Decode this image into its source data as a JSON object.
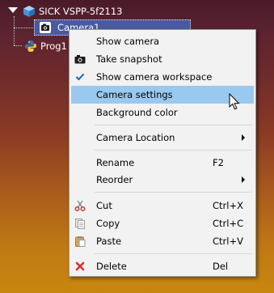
{
  "tree": {
    "root_label": "SICK VSPP-5f2113",
    "camera_label": "Camera1",
    "program_label": "Prog1"
  },
  "menu": {
    "items": [
      {
        "label": "Show camera",
        "shortcut": "",
        "icon": "none",
        "submenu": false,
        "highlighted": false
      },
      {
        "label": "Take snapshot",
        "shortcut": "",
        "icon": "camera-icon",
        "submenu": false,
        "highlighted": false
      },
      {
        "label": "Show camera workspace",
        "shortcut": "",
        "icon": "checkmark-icon",
        "submenu": false,
        "highlighted": false
      },
      {
        "label": "Camera settings",
        "shortcut": "",
        "icon": "none",
        "submenu": false,
        "highlighted": true
      },
      {
        "label": "Background color",
        "shortcut": "",
        "icon": "none",
        "submenu": false,
        "highlighted": false
      },
      {
        "label": "Camera Location",
        "shortcut": "",
        "icon": "none",
        "submenu": true,
        "highlighted": false
      },
      {
        "label": "Rename",
        "shortcut": "F2",
        "icon": "none",
        "submenu": false,
        "highlighted": false
      },
      {
        "label": "Reorder",
        "shortcut": "",
        "icon": "none",
        "submenu": true,
        "highlighted": false
      },
      {
        "label": "Cut",
        "shortcut": "Ctrl+X",
        "icon": "scissors-icon",
        "submenu": false,
        "highlighted": false
      },
      {
        "label": "Copy",
        "shortcut": "Ctrl+C",
        "icon": "copy-icon",
        "submenu": false,
        "highlighted": false
      },
      {
        "label": "Paste",
        "shortcut": "Ctrl+V",
        "icon": "paste-icon",
        "submenu": false,
        "highlighted": false
      },
      {
        "label": "Delete",
        "shortcut": "Del",
        "icon": "delete-x-icon",
        "submenu": false,
        "highlighted": false
      }
    ]
  },
  "colors": {
    "highlight": "#99c9ef",
    "menu_bg": "#f2f2f2",
    "selected_node": "#4a5aa0",
    "delete_red": "#d9302c",
    "cut_red": "#c43c3c",
    "check_blue": "#1f5fbf"
  }
}
